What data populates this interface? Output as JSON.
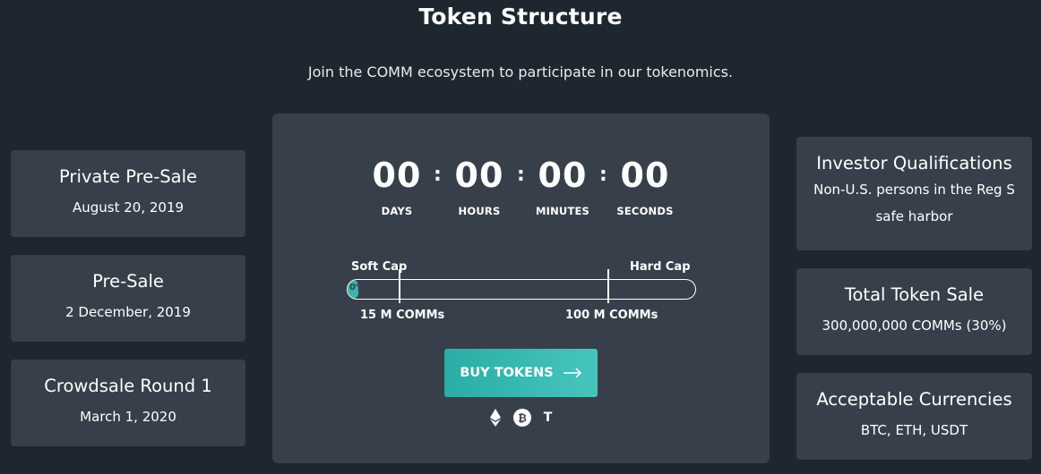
{
  "header": {
    "title": "Token Structure",
    "subtitle": "Join the COMM ecosystem to participate in our tokenomics."
  },
  "left_cards": [
    {
      "title": "Private Pre-Sale",
      "value": "August 20, 2019"
    },
    {
      "title": "Pre-Sale",
      "value": "2 December, 2019"
    },
    {
      "title": "Crowdsale Round 1",
      "value": "March 1, 2020"
    }
  ],
  "right_cards": [
    {
      "title": "Investor Qualifications",
      "value": "Non-U.S. persons in the Reg S safe harbor"
    },
    {
      "title": "Total Token Sale",
      "value": "300,000,000 COMMs (30%)"
    },
    {
      "title": "Acceptable Currencies",
      "value": "BTC, ETH, USDT"
    }
  ],
  "countdown": {
    "days": "00",
    "hours": "00",
    "minutes": "00",
    "seconds": "00",
    "days_label": "DAYS",
    "hours_label": "HOURS",
    "minutes_label": "MINUTES",
    "seconds_label": "SECONDS",
    "separator": ":"
  },
  "progress": {
    "soft_cap_label": "Soft Cap",
    "hard_cap_label": "Hard Cap",
    "soft_cap_amount": "15 M COMMs",
    "hard_cap_amount": "100 M COMMs",
    "percent_text": "0%",
    "fill_fraction": 0.0
  },
  "buy": {
    "label": "BUY TOKENS",
    "arrow_icon": "arrow-right-icon"
  },
  "currencies": [
    {
      "icon": "ethereum-icon"
    },
    {
      "icon": "bitcoin-icon"
    },
    {
      "icon": "tether-icon",
      "glyph": "T"
    }
  ],
  "colors": {
    "background": "#1e2730",
    "card": "#37404a",
    "accent": "#3bb5ad",
    "text": "#ffffff"
  }
}
